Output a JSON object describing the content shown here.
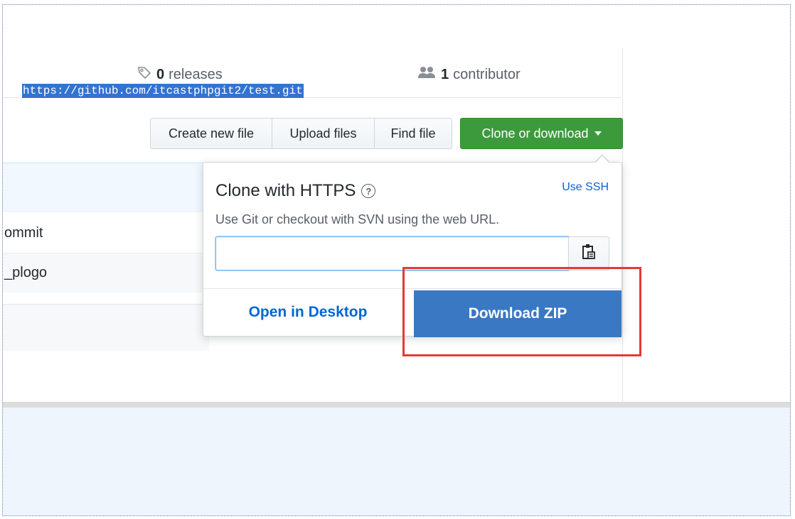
{
  "repo_summary": {
    "releases_count": "0",
    "releases_label": "releases",
    "contributors_count": "1",
    "contributors_label": "contributor"
  },
  "toolbar": {
    "create_new_file": "Create new file",
    "upload_files": "Upload files",
    "find_file": "Find file",
    "clone_or_download": "Clone or download"
  },
  "file_list": {
    "rows": [
      {
        "text": "ommit"
      },
      {
        "text": "_plogo"
      }
    ]
  },
  "clone_popover": {
    "title": "Clone with HTTPS",
    "help_icon": "?",
    "use_ssh": "Use SSH",
    "description": "Use Git or checkout with SVN using the web URL.",
    "url": "https://github.com/itcastphpgit2/test.git",
    "open_in_desktop": "Open in Desktop",
    "download_zip": "Download ZIP"
  },
  "icons": {
    "tag": "tag-icon",
    "people": "people-icon",
    "clipboard": "clipboard-icon",
    "caret": "caret-down-icon"
  },
  "colors": {
    "clone_button": "#3c9a3c",
    "download_zip_bg": "#3b78c3",
    "link": "#0366d6",
    "highlight_box": "#e53935",
    "selection": "#3373d1",
    "bottom_band": "#eef5fd"
  }
}
